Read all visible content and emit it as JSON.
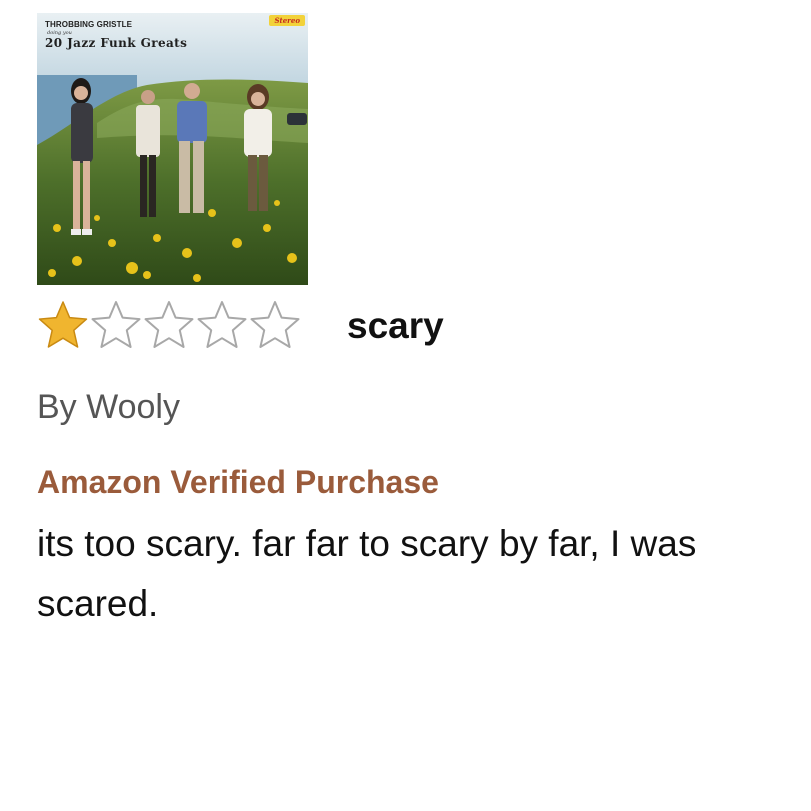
{
  "album": {
    "artist": "THROBBING GRISTLE",
    "by_line": "doing you",
    "title": "20 Jazz Funk Greats",
    "badge": "Stereo"
  },
  "review": {
    "rating": 1,
    "rating_max": 5,
    "title": "scary",
    "author": "By Wooly",
    "verified_label": "Amazon Verified Purchase",
    "body": "its too scary. far far to scary by far, I was scared."
  },
  "colors": {
    "star_filled": "#f0b52f",
    "star_outline": "#a8a8a8",
    "verified": "#9a5b3b",
    "title_text": "#111111",
    "author_text": "#555555"
  },
  "icons": {
    "star_filled": "star-filled-icon",
    "star_empty": "star-empty-icon"
  }
}
